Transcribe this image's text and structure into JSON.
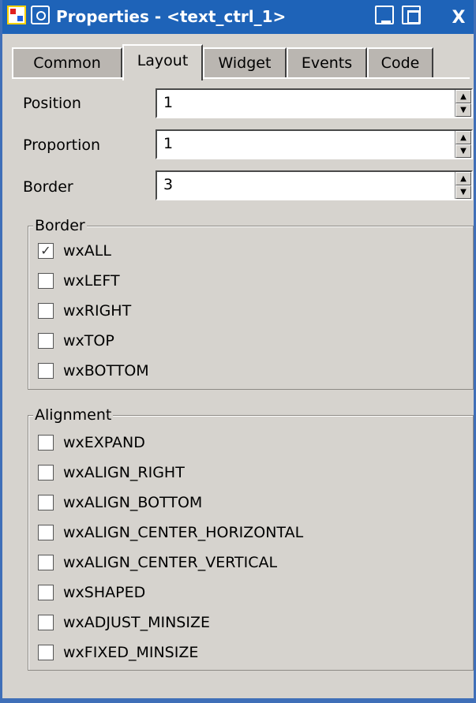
{
  "window": {
    "title": "Properties - <text_ctrl_1>",
    "close_label": "X"
  },
  "tabs": [
    {
      "label": "Common",
      "active": false
    },
    {
      "label": "Layout",
      "active": true
    },
    {
      "label": "Widget",
      "active": false
    },
    {
      "label": "Events",
      "active": false
    },
    {
      "label": "Code",
      "active": false
    }
  ],
  "fields": {
    "position": {
      "label": "Position",
      "value": "1"
    },
    "proportion": {
      "label": "Proportion",
      "value": "1"
    },
    "border": {
      "label": "Border",
      "value": "3"
    }
  },
  "border_group": {
    "title": "Border",
    "items": [
      {
        "label": "wxALL",
        "checked": true
      },
      {
        "label": "wxLEFT",
        "checked": false
      },
      {
        "label": "wxRIGHT",
        "checked": false
      },
      {
        "label": "wxTOP",
        "checked": false
      },
      {
        "label": "wxBOTTOM",
        "checked": false
      }
    ]
  },
  "alignment_group": {
    "title": "Alignment",
    "items": [
      {
        "label": "wxEXPAND",
        "checked": false
      },
      {
        "label": "wxALIGN_RIGHT",
        "checked": false
      },
      {
        "label": "wxALIGN_BOTTOM",
        "checked": false
      },
      {
        "label": "wxALIGN_CENTER_HORIZONTAL",
        "checked": false
      },
      {
        "label": "wxALIGN_CENTER_VERTICAL",
        "checked": false
      },
      {
        "label": "wxSHAPED",
        "checked": false
      },
      {
        "label": "wxADJUST_MINSIZE",
        "checked": false
      },
      {
        "label": "wxFIXED_MINSIZE",
        "checked": false
      }
    ]
  },
  "colors": {
    "titlebar": "#1e63b8",
    "face": "#d6d3ce"
  },
  "icons": {
    "app": "app-icon",
    "menu": "window-menu-icon",
    "minimize": "minimize-icon",
    "maximize": "maximize-icon",
    "close": "close-icon"
  }
}
